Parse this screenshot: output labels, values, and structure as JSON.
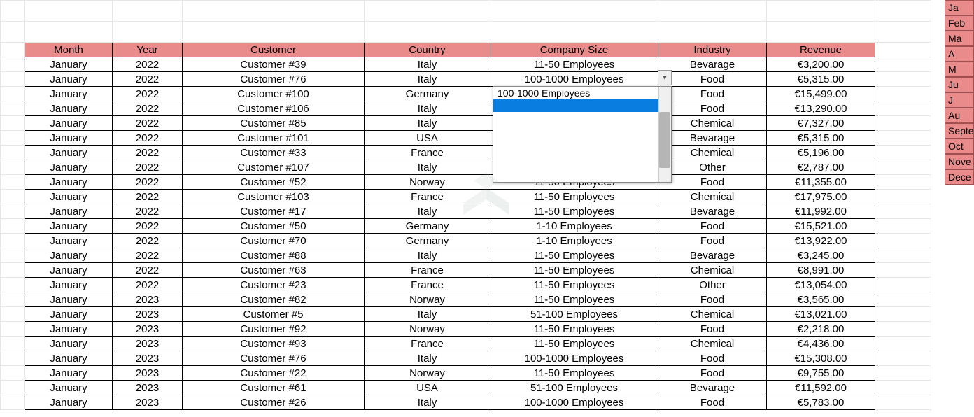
{
  "headers": {
    "month": "Month",
    "year": "Year",
    "customer": "Customer",
    "country": "Country",
    "size": "Company Size",
    "industry": "Industry",
    "revenue": "Revenue"
  },
  "rows": [
    {
      "month": "January",
      "year": "2022",
      "customer": "Customer #39",
      "country": "Italy",
      "size": "11-50 Employees",
      "industry": "Bevarage",
      "revenue": "€3,200.00"
    },
    {
      "month": "January",
      "year": "2022",
      "customer": "Customer #76",
      "country": "Italy",
      "size": "100-1000 Employees",
      "industry": "Food",
      "revenue": "€5,315.00"
    },
    {
      "month": "January",
      "year": "2022",
      "customer": "Customer #100",
      "country": "Germany",
      "size": "",
      "industry": "Food",
      "revenue": "€15,499.00"
    },
    {
      "month": "January",
      "year": "2022",
      "customer": "Customer #106",
      "country": "Italy",
      "size": "",
      "industry": "Food",
      "revenue": "€13,290.00"
    },
    {
      "month": "January",
      "year": "2022",
      "customer": "Customer #85",
      "country": "Italy",
      "size": "",
      "industry": "Chemical",
      "revenue": "€7,327.00"
    },
    {
      "month": "January",
      "year": "2022",
      "customer": "Customer #101",
      "country": "USA",
      "size": "",
      "industry": "Bevarage",
      "revenue": "€5,315.00"
    },
    {
      "month": "January",
      "year": "2022",
      "customer": "Customer #33",
      "country": "France",
      "size": "",
      "industry": "Chemical",
      "revenue": "€5,196.00"
    },
    {
      "month": "January",
      "year": "2022",
      "customer": "Customer #107",
      "country": "Italy",
      "size": "",
      "industry": "Other",
      "revenue": "€2,787.00"
    },
    {
      "month": "January",
      "year": "2022",
      "customer": "Customer #52",
      "country": "Norway",
      "size": "11-50 Employees",
      "industry": "Food",
      "revenue": "€11,355.00"
    },
    {
      "month": "January",
      "year": "2022",
      "customer": "Customer #103",
      "country": "France",
      "size": "11-50 Employees",
      "industry": "Chemical",
      "revenue": "€17,975.00"
    },
    {
      "month": "January",
      "year": "2022",
      "customer": "Customer #17",
      "country": "Italy",
      "size": "11-50 Employees",
      "industry": "Bevarage",
      "revenue": "€11,992.00"
    },
    {
      "month": "January",
      "year": "2022",
      "customer": "Customer #50",
      "country": "Germany",
      "size": "1-10 Employees",
      "industry": "Food",
      "revenue": "€15,521.00"
    },
    {
      "month": "January",
      "year": "2022",
      "customer": "Customer #70",
      "country": "Germany",
      "size": "1-10 Employees",
      "industry": "Food",
      "revenue": "€13,922.00"
    },
    {
      "month": "January",
      "year": "2022",
      "customer": "Customer #88",
      "country": "Italy",
      "size": "11-50 Employees",
      "industry": "Bevarage",
      "revenue": "€3,245.00"
    },
    {
      "month": "January",
      "year": "2022",
      "customer": "Customer #63",
      "country": "France",
      "size": "11-50 Employees",
      "industry": "Chemical",
      "revenue": "€8,991.00"
    },
    {
      "month": "January",
      "year": "2022",
      "customer": "Customer #23",
      "country": "France",
      "size": "11-50 Employees",
      "industry": "Other",
      "revenue": "€13,054.00"
    },
    {
      "month": "January",
      "year": "2023",
      "customer": "Customer #82",
      "country": "Norway",
      "size": "11-50 Employees",
      "industry": "Food",
      "revenue": "€3,565.00"
    },
    {
      "month": "January",
      "year": "2023",
      "customer": "Customer #5",
      "country": "Italy",
      "size": "51-100 Employees",
      "industry": "Chemical",
      "revenue": "€13,021.00"
    },
    {
      "month": "January",
      "year": "2023",
      "customer": "Customer #92",
      "country": "Norway",
      "size": "11-50 Employees",
      "industry": "Food",
      "revenue": "€2,218.00"
    },
    {
      "month": "January",
      "year": "2023",
      "customer": "Customer #93",
      "country": "France",
      "size": "11-50 Employees",
      "industry": "Chemical",
      "revenue": "€4,436.00"
    },
    {
      "month": "January",
      "year": "2023",
      "customer": "Customer #76",
      "country": "Italy",
      "size": "100-1000 Employees",
      "industry": "Food",
      "revenue": "€15,308.00"
    },
    {
      "month": "January",
      "year": "2023",
      "customer": "Customer #22",
      "country": "Norway",
      "size": "11-50 Employees",
      "industry": "Food",
      "revenue": "€9,755.00"
    },
    {
      "month": "January",
      "year": "2023",
      "customer": "Customer #61",
      "country": "USA",
      "size": "51-100 Employees",
      "industry": "Bevarage",
      "revenue": "€11,592.00"
    },
    {
      "month": "January",
      "year": "2023",
      "customer": "Customer #26",
      "country": "Italy",
      "size": "100-1000 Employees",
      "industry": "Food",
      "revenue": "€5,783.00"
    }
  ],
  "dropdown": {
    "visible_option": "100-1000 Employees",
    "selected_option": ""
  },
  "months_slicer": [
    "Ja",
    "Feb",
    "Ma",
    "A",
    "M",
    "Ju",
    "J",
    "Au",
    "Septe",
    "Oct",
    "Nove",
    "Dece"
  ]
}
